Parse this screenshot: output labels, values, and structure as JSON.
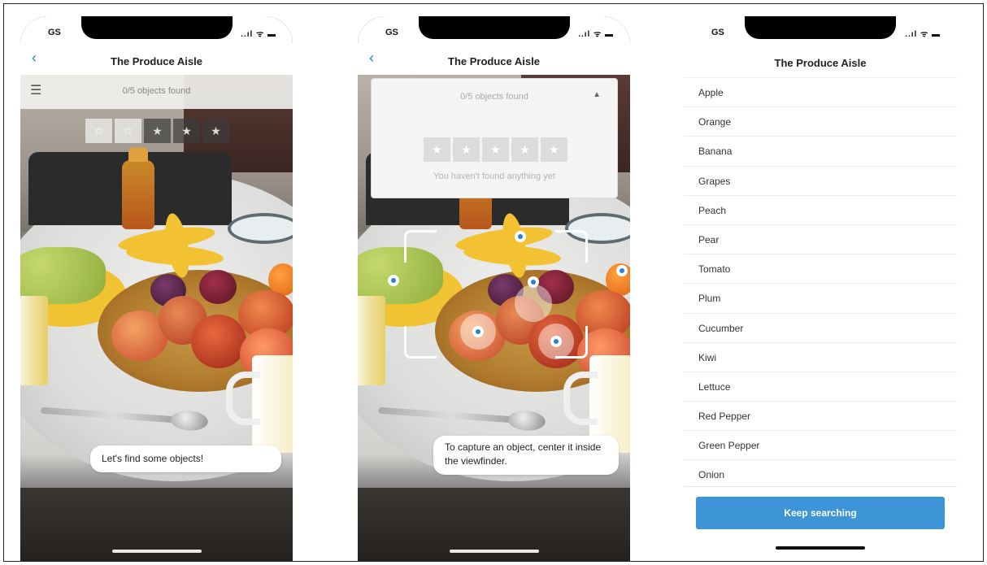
{
  "screens": [
    {
      "status": {
        "time": "GS",
        "icons": "..ıl ᯤ ▬"
      },
      "nav": {
        "back_icon": "‹",
        "title": "The Produce Aisle"
      },
      "found_bar": {
        "list_icon": "☰",
        "text": "0/5 objects found"
      },
      "stars": [
        "☆",
        "☆",
        "★",
        "★",
        "★"
      ],
      "toast": "Let's find some objects!"
    },
    {
      "status": {
        "time": "GS",
        "icons": "..ıl ᯤ ▬"
      },
      "nav": {
        "back_icon": "‹",
        "title": "The Produce Aisle"
      },
      "dropdown": {
        "found_text": "0/5 objects found",
        "caret": "▲",
        "stars": [
          "★",
          "★",
          "★",
          "★",
          "★"
        ],
        "message": "You haven't found anything yet"
      },
      "toast": "To capture an object, center it inside the viewfinder."
    },
    {
      "status": {
        "time": "GS",
        "icons": "..ıl ᯤ ▬"
      },
      "nav": {
        "title": "The Produce Aisle"
      },
      "items": [
        "Apple",
        "Orange",
        "Banana",
        "Grapes",
        "Peach",
        "Pear",
        "Tomato",
        "Plum",
        "Cucumber",
        "Kiwi",
        "Lettuce",
        "Red Pepper",
        "Green Pepper",
        "Onion"
      ],
      "button": "Keep searching"
    }
  ],
  "colors": {
    "accent": "#2d7fd6",
    "button": "#3d95d8"
  }
}
